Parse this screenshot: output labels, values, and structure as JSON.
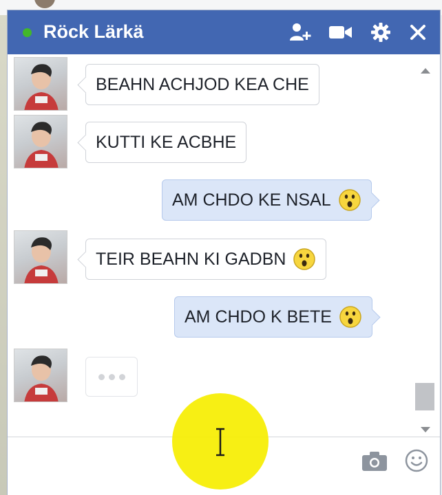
{
  "chat": {
    "title": "Röck Lärkä",
    "messages": [
      {
        "from": "them",
        "text": "BEAHN ACHJOD KEA CHE",
        "emoji": ""
      },
      {
        "from": "them",
        "text": "KUTTI KE ACBHE",
        "emoji": ""
      },
      {
        "from": "me",
        "text": "AM CHDO KE NSAL",
        "emoji": "surprised-emoji"
      },
      {
        "from": "them",
        "text": "TEIR BEAHN KI GADBN",
        "emoji": "surprised-emoji"
      },
      {
        "from": "me",
        "text": "AM CHDO K BETE",
        "emoji": "surprised-emoji"
      }
    ]
  },
  "titlebar_icons": [
    "add-friend-icon",
    "video-call-icon",
    "gear-icon",
    "close-icon"
  ],
  "composer_icons": [
    "camera-icon",
    "smiley-icon"
  ],
  "colors": {
    "titlebar": "#4267b2",
    "online": "#42b72a",
    "outgoing_bubble": "#dbe6f8",
    "cursor_highlight": "#f6ee00"
  }
}
